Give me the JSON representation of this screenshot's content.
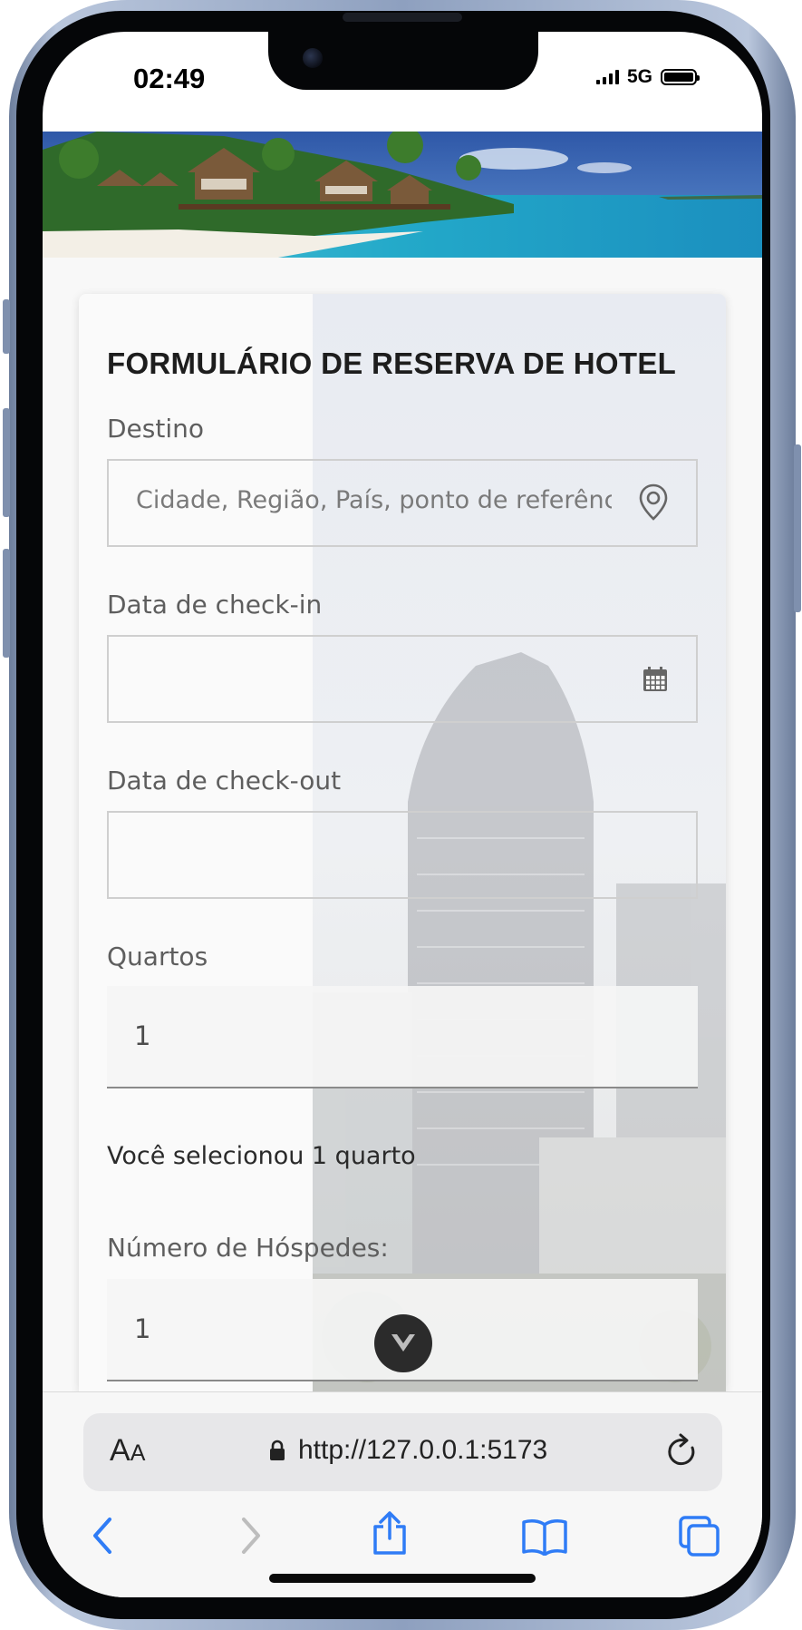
{
  "status": {
    "time": "02:49",
    "network": "5G"
  },
  "form": {
    "title": "FORMULÁRIO DE RESERVA DE HOTEL",
    "destination": {
      "label": "Destino",
      "placeholder": "Cidade, Região, País, ponto de referência"
    },
    "checkin": {
      "label": "Data de check-in",
      "value": ""
    },
    "checkout": {
      "label": "Data de check-out",
      "value": ""
    },
    "rooms": {
      "label": "Quartos",
      "value": "1",
      "helper": "Você selecionou 1 quarto"
    },
    "guests": {
      "label": "Número de Hóspedes:",
      "value": "1"
    }
  },
  "browser": {
    "text_size_big": "A",
    "text_size_small": "A",
    "url": "http://127.0.0.1:5173"
  },
  "icons": {
    "destination": "map-pin-icon",
    "checkin": "calendar-icon",
    "scroll": "chevron-down-icon",
    "lock": "lock-icon",
    "reload": "reload-icon",
    "back": "back-arrow-icon",
    "forward": "forward-arrow-icon",
    "share": "share-icon",
    "bookmarks": "bookmarks-icon",
    "tabs": "tabs-icon"
  },
  "colors": {
    "safari_accent": "#2f7cf6",
    "disabled": "#bdbdbd"
  }
}
